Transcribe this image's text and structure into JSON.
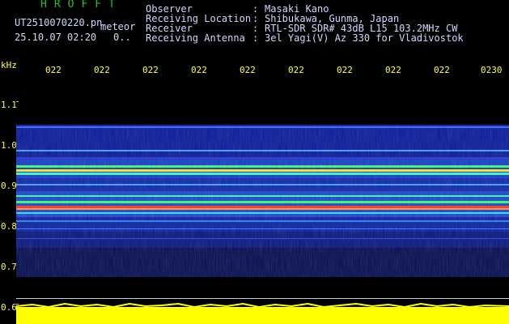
{
  "header": {
    "app_title": "HROFFT",
    "file_name": "UT2510070220.pn",
    "meteor_label": "meteor",
    "datetime": "25.10.07 02:20",
    "counter": "0..",
    "fields": [
      {
        "label": "Observer",
        "sep": ":",
        "value": "Masaki Kano"
      },
      {
        "label": "Receiving Location",
        "sep": ":",
        "value": "Shibukawa, Gunma, Japan"
      },
      {
        "label": "Receiver",
        "sep": ":",
        "value": "RTL-SDR SDR# 43dB L15 103.2MHz CW"
      },
      {
        "label": "Receiving Antenna",
        "sep": ":",
        "value": "3el Yagi(V) Az 330 for Vladivostok"
      }
    ]
  },
  "axis": {
    "y_unit": "kHz",
    "y_ticks": [
      "1.1",
      "1.0",
      "0.9",
      "0.8",
      "0.7",
      "0.6"
    ],
    "x_ticks": [
      "022",
      "022",
      "022",
      "022",
      "022",
      "022",
      "022",
      "022",
      "022",
      "0230"
    ]
  },
  "colors": {
    "background": "#000000",
    "label_yellow": "#ffff33",
    "title_green": "#21c521",
    "noise_floor_blue": "#0a1a9a",
    "signal_green": "#33ff66",
    "signal_red": "#ff3333",
    "bottom_bar_yellow": "#ffff00"
  }
}
